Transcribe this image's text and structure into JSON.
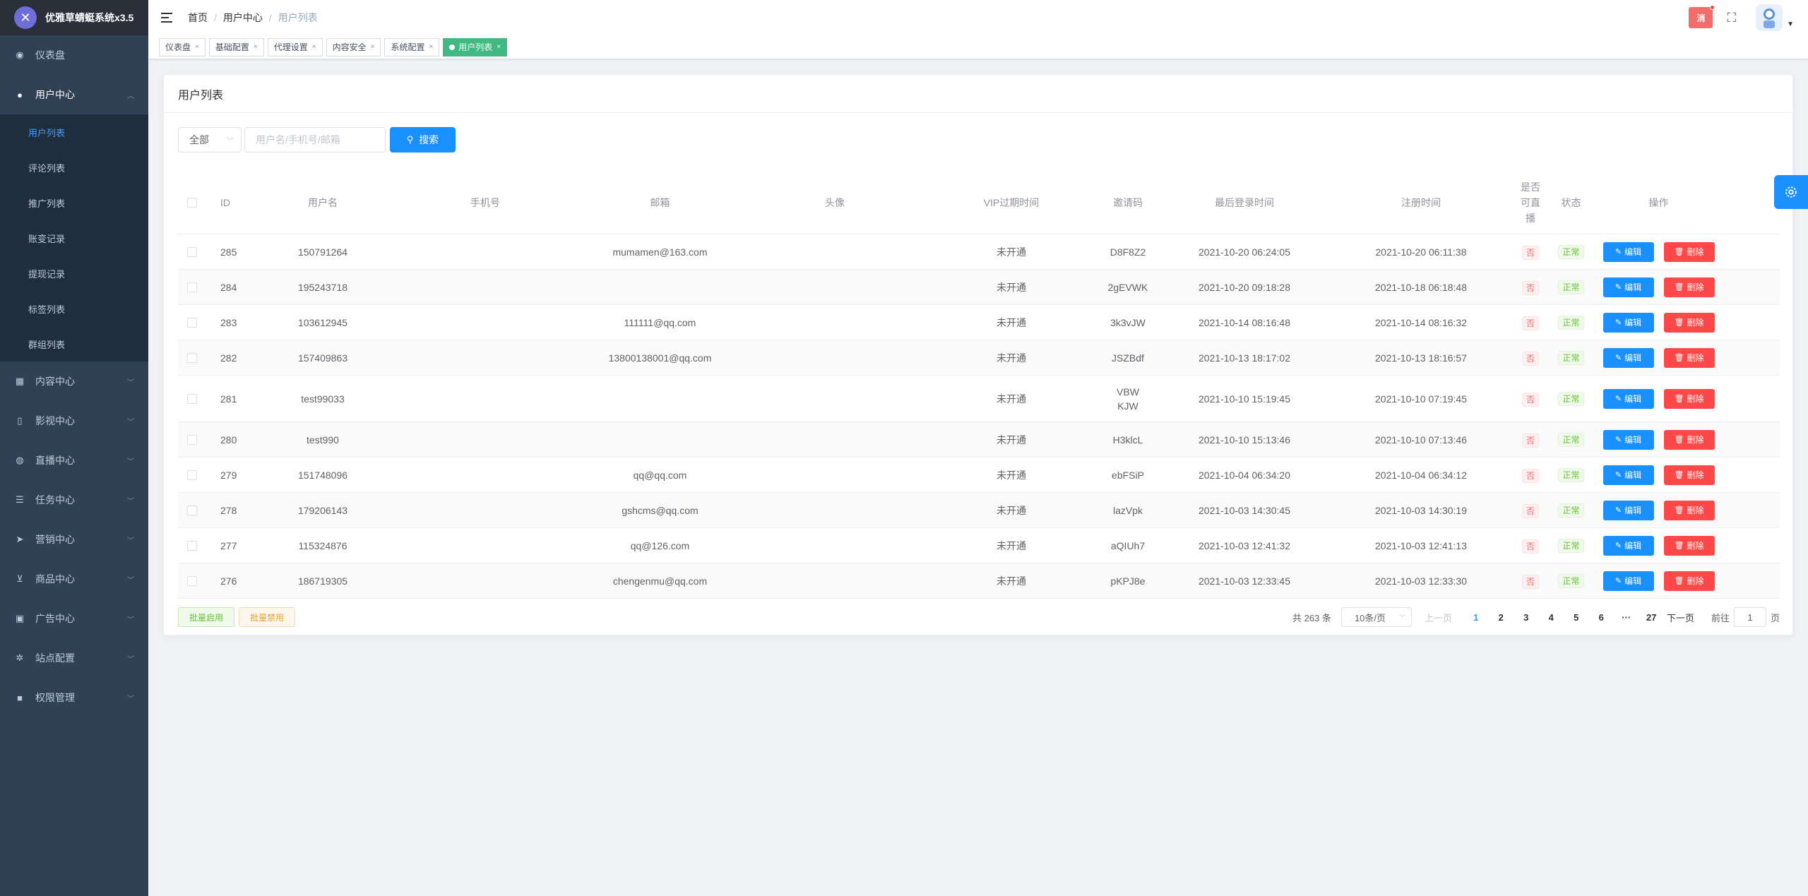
{
  "app": {
    "title": "优雅草蜻蜓系统x3.5"
  },
  "sidebar": {
    "items": [
      {
        "label": "仪表盘",
        "icon": "dashboard-icon"
      },
      {
        "label": "用户中心",
        "icon": "user-icon"
      },
      {
        "label": "内容中心",
        "icon": "grid-icon"
      },
      {
        "label": "影视中心",
        "icon": "book-icon"
      },
      {
        "label": "直播中心",
        "icon": "globe-icon"
      },
      {
        "label": "任务中心",
        "icon": "list-icon"
      },
      {
        "label": "营销中心",
        "icon": "send-icon"
      },
      {
        "label": "商品中心",
        "icon": "cart-icon"
      },
      {
        "label": "广告中心",
        "icon": "ad-icon"
      },
      {
        "label": "站点配置",
        "icon": "settings-icon"
      },
      {
        "label": "权限管理",
        "icon": "lock-icon"
      }
    ],
    "user_sub": [
      "用户列表",
      "评论列表",
      "推广列表",
      "账变记录",
      "提现记录",
      "标签列表",
      "群组列表"
    ]
  },
  "header": {
    "breadcrumb": [
      "首页",
      "用户中心",
      "用户列表"
    ],
    "notice_label": "消"
  },
  "tags": [
    {
      "label": "仪表盘"
    },
    {
      "label": "基础配置"
    },
    {
      "label": "代理设置"
    },
    {
      "label": "内容安全"
    },
    {
      "label": "系统配置"
    },
    {
      "label": "用户列表"
    }
  ],
  "card": {
    "title": "用户列表"
  },
  "filters": {
    "select_value": "全部",
    "search_placeholder": "用户名/手机号/邮箱",
    "search_label": "搜索"
  },
  "table": {
    "headers": {
      "id": "ID",
      "username": "用户名",
      "phone": "手机号",
      "email": "邮箱",
      "avatar": "头像",
      "vip": "VIP过期时间",
      "code": "邀请码",
      "last_login": "最后登录时间",
      "register": "注册时间",
      "live": "是否可直播",
      "status": "状态",
      "ops": "操作"
    },
    "edit_label": "编辑",
    "delete_label": "删除",
    "rows": [
      {
        "id": "285",
        "username": "150791264",
        "phone": "",
        "email": "mumamen@163.com",
        "vip": "未开通",
        "code": "D8F8Z2",
        "last_login": "2021-10-20 06:24:05",
        "register": "2021-10-20 06:11:38",
        "live": "否",
        "status": "正常"
      },
      {
        "id": "284",
        "username": "195243718",
        "phone": "",
        "email": "",
        "vip": "未开通",
        "code": "2gEVWK",
        "last_login": "2021-10-20 09:18:28",
        "register": "2021-10-18 06:18:48",
        "live": "否",
        "status": "正常"
      },
      {
        "id": "283",
        "username": "103612945",
        "phone": "",
        "email": "111111@qq.com",
        "vip": "未开通",
        "code": "3k3vJW",
        "last_login": "2021-10-14 08:16:48",
        "register": "2021-10-14 08:16:32",
        "live": "否",
        "status": "正常"
      },
      {
        "id": "282",
        "username": "157409863",
        "phone": "",
        "email": "13800138001@qq.com",
        "vip": "未开通",
        "code": "JSZBdf",
        "last_login": "2021-10-13 18:17:02",
        "register": "2021-10-13 18:16:57",
        "live": "否",
        "status": "正常"
      },
      {
        "id": "281",
        "username": "test99033",
        "phone": "",
        "email": "",
        "vip": "未开通",
        "code": "VBWKJW",
        "last_login": "2021-10-10 15:19:45",
        "register": "2021-10-10 07:19:45",
        "live": "否",
        "status": "正常"
      },
      {
        "id": "280",
        "username": "test990",
        "phone": "",
        "email": "",
        "vip": "未开通",
        "code": "H3klcL",
        "last_login": "2021-10-10 15:13:46",
        "register": "2021-10-10 07:13:46",
        "live": "否",
        "status": "正常"
      },
      {
        "id": "279",
        "username": "151748096",
        "phone": "",
        "email": "qq@qq.com",
        "vip": "未开通",
        "code": "ebFSiP",
        "last_login": "2021-10-04 06:34:20",
        "register": "2021-10-04 06:34:12",
        "live": "否",
        "status": "正常"
      },
      {
        "id": "278",
        "username": "179206143",
        "phone": "",
        "email": "gshcms@qq.com",
        "vip": "未开通",
        "code": "lazVpk",
        "last_login": "2021-10-03 14:30:45",
        "register": "2021-10-03 14:30:19",
        "live": "否",
        "status": "正常"
      },
      {
        "id": "277",
        "username": "115324876",
        "phone": "",
        "email": "qq@126.com",
        "vip": "未开通",
        "code": "aQIUh7",
        "last_login": "2021-10-03 12:41:32",
        "register": "2021-10-03 12:41:13",
        "live": "否",
        "status": "正常"
      },
      {
        "id": "276",
        "username": "186719305",
        "phone": "",
        "email": "chengenmu@qq.com",
        "vip": "未开通",
        "code": "pKPJ8e",
        "last_login": "2021-10-03 12:33:45",
        "register": "2021-10-03 12:33:30",
        "live": "否",
        "status": "正常"
      }
    ]
  },
  "footer": {
    "enable_label": "批量启用",
    "disable_label": "批量禁用"
  },
  "pagination": {
    "total": "共 263 条",
    "page_size": "10条/页",
    "prev": "上一页",
    "pages": [
      "1",
      "2",
      "3",
      "4",
      "5",
      "6",
      "···",
      "27"
    ],
    "current": "1",
    "next": "下一页",
    "goto_label": "前往",
    "goto_value": "1",
    "goto_suffix": "页"
  },
  "colors": {
    "sidebar_bg": "#304156",
    "primary": "#1890ff",
    "danger": "#ff4949",
    "tag_active": "#42b983"
  }
}
